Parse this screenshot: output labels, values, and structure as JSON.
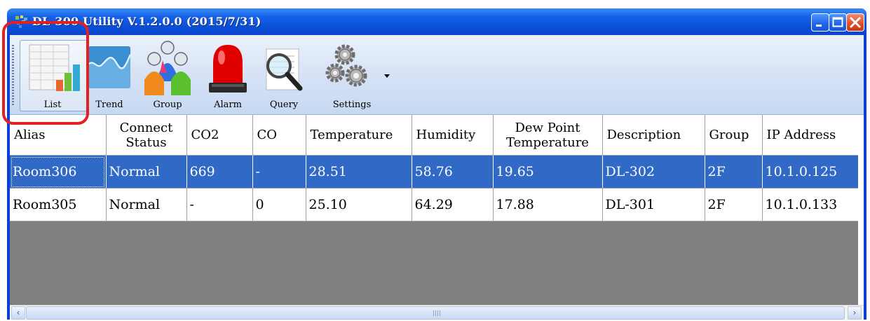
{
  "window": {
    "title": "DL-300 Utility V.1.2.0.0 (2015/7/31)",
    "controls": {
      "minimize": "minimize-icon",
      "maximize": "maximize-icon",
      "close": "close-icon"
    }
  },
  "toolbar": {
    "items": [
      {
        "label": "List",
        "icon": "list-icon"
      },
      {
        "label": "Trend",
        "icon": "trend-icon"
      },
      {
        "label": "Group",
        "icon": "group-icon"
      },
      {
        "label": "Alarm",
        "icon": "alarm-icon"
      },
      {
        "label": "Query",
        "icon": "query-icon"
      },
      {
        "label": "Settings",
        "icon": "settings-icon"
      }
    ]
  },
  "table": {
    "columns": [
      "Alias",
      "Connect Status",
      "CO2",
      "CO",
      "Temperature",
      "Humidity",
      "Dew Point Temperature",
      "Description",
      "Group",
      "IP Address"
    ],
    "rows": [
      [
        "Room306",
        "Normal",
        "669",
        "-",
        "28.51",
        "58.76",
        "19.65",
        "DL-302",
        "2F",
        "10.1.0.125"
      ],
      [
        "Room305",
        "Normal",
        "-",
        "0",
        "25.10",
        "64.29",
        "17.88",
        "DL-301",
        "2F",
        "10.1.0.133"
      ]
    ],
    "selected_row": 0
  },
  "colors": {
    "titlebar": "#0a4fd8",
    "selection": "#3169c6",
    "highlight_box": "#e52020",
    "empty_grid": "#808080"
  }
}
